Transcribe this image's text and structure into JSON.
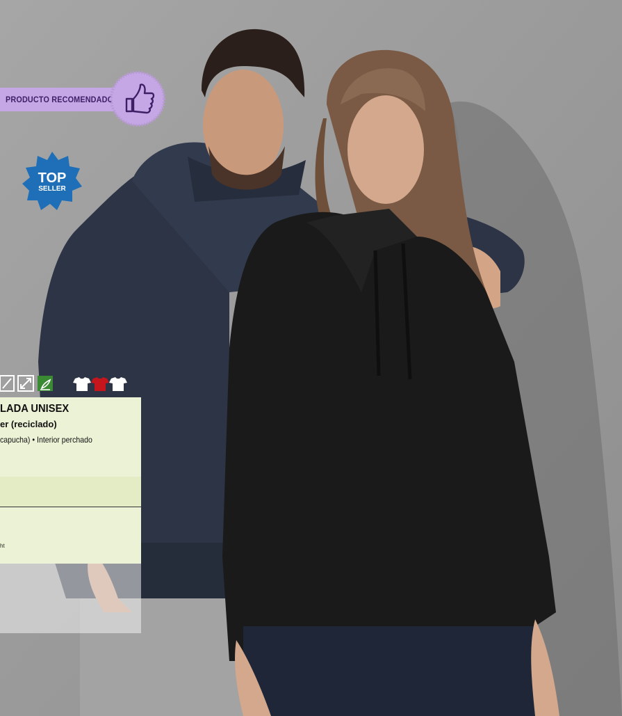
{
  "badges": {
    "recommended": "PRODUCTO RECOMENDADO",
    "top": "TOP",
    "seller": "SELLER"
  },
  "icons": [
    "pencil-icon",
    "expand-icon",
    "eco-leaf-icon",
    "tshirt-white-icon",
    "tshirt-red-icon",
    "tshirt-white-icon"
  ],
  "product": {
    "title": "LADA UNISEX",
    "subtitle": "er (reciclado)",
    "description": "capucha) • Interior perchado",
    "note": "ht"
  },
  "colors": {
    "background": "#9a9a9a",
    "panel": "#ecf2d6",
    "recommended_badge": "#c6a7e6",
    "top_seller": "#1f6fb8",
    "hoodie_navy": "#2c3445",
    "hoodie_black": "#1a1a1a",
    "eco_green": "#3a8a34",
    "tshirt_red": "#c4161c"
  }
}
